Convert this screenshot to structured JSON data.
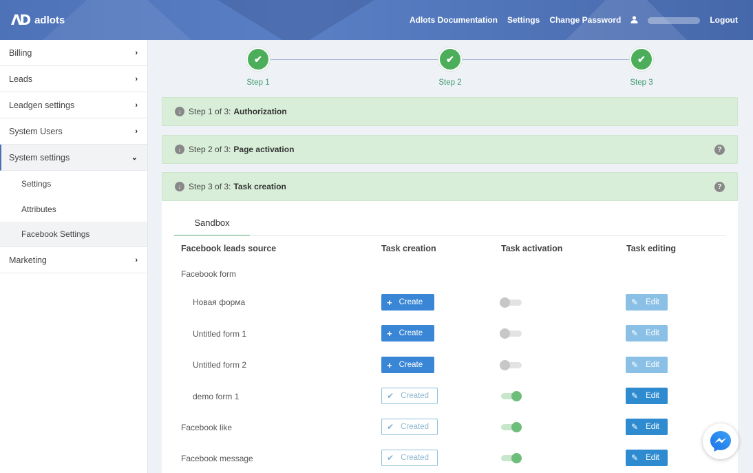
{
  "header": {
    "logo_mark": "ΛD",
    "logo_text": "adlots",
    "nav": {
      "documentation": "Adlots Documentation",
      "settings": "Settings",
      "change_password": "Change Password",
      "logout": "Logout"
    }
  },
  "sidebar": {
    "items": [
      {
        "label": "Billing",
        "chevron": "›"
      },
      {
        "label": "Leads",
        "chevron": "›"
      },
      {
        "label": "Leadgen settings",
        "chevron": "›"
      },
      {
        "label": "System Users",
        "chevron": "›"
      },
      {
        "label": "System settings",
        "chevron": "⌄"
      }
    ],
    "sub_items": [
      "Settings",
      "Attributes",
      "Facebook Settings"
    ],
    "bottom_item": {
      "label": "Marketing",
      "chevron": "›"
    }
  },
  "steps": [
    {
      "label": "Step 1",
      "done": true
    },
    {
      "label": "Step 2",
      "done": true
    },
    {
      "label": "Step 3",
      "done": true
    }
  ],
  "panels": [
    {
      "prefix": "Step 1 of 3:",
      "title": "Authorization"
    },
    {
      "prefix": "Step 2 of 3:",
      "title": "Page activation"
    },
    {
      "prefix": "Step 3 of 3:",
      "title": "Task creation"
    }
  ],
  "card": {
    "tab": "Sandbox",
    "headers": {
      "source": "Facebook leads source",
      "creation": "Task creation",
      "activation": "Task activation",
      "editing": "Task editing"
    },
    "group_label": "Facebook form",
    "rows": [
      {
        "label": "Новая форма",
        "creation": "Create",
        "active": false,
        "edit": "Edit",
        "edit_enabled": false
      },
      {
        "label": "Untitled form 1",
        "creation": "Create",
        "active": false,
        "edit": "Edit",
        "edit_enabled": false
      },
      {
        "label": "Untitled form 2",
        "creation": "Create",
        "active": false,
        "edit": "Edit",
        "edit_enabled": false
      },
      {
        "label": "demo form 1",
        "creation": "Created",
        "active": true,
        "edit": "Edit",
        "edit_enabled": true
      },
      {
        "label": "Facebook like",
        "creation": "Created",
        "active": true,
        "edit": "Edit",
        "edit_enabled": true
      },
      {
        "label": "Facebook message",
        "creation": "Created",
        "active": true,
        "edit": "Edit",
        "edit_enabled": true
      }
    ]
  },
  "icons": {
    "plus": "+",
    "check": "✔",
    "pencil": "✎",
    "help": "?",
    "arrow_down": "↓",
    "user": "👤"
  },
  "colors": {
    "header": "#4e72b8",
    "step_green": "#4cae5a",
    "panel_green": "#d8eed8",
    "create_blue": "#3a86d6",
    "edit_blue": "#2f8bd0"
  }
}
